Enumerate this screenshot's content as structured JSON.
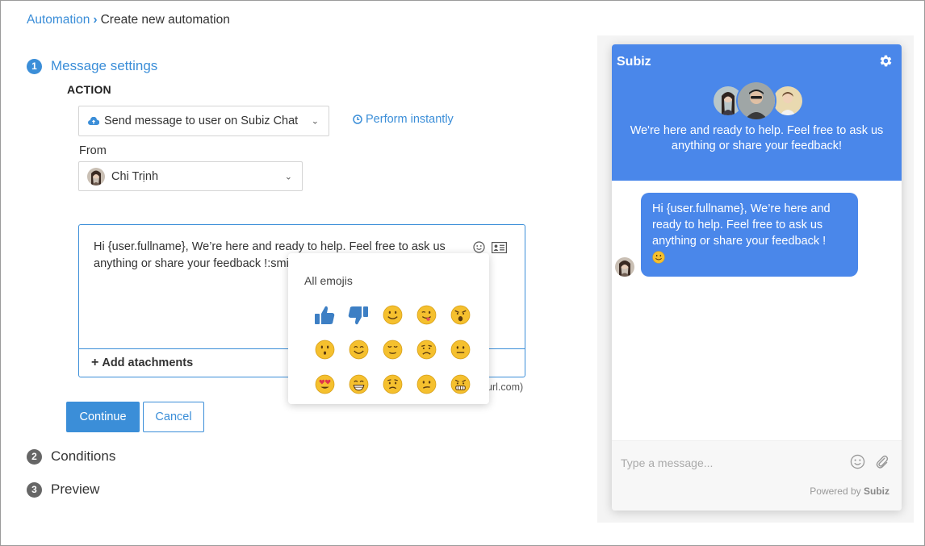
{
  "breadcrumb": {
    "parent": "Automation",
    "separator": "›",
    "current": "Create new automation"
  },
  "steps": [
    {
      "num": "1",
      "label": "Message settings",
      "state": "active"
    },
    {
      "num": "2",
      "label": "Conditions",
      "state": "inactive"
    },
    {
      "num": "3",
      "label": "Preview",
      "state": "inactive"
    }
  ],
  "action": {
    "label": "ACTION",
    "select_value": "Send message to user on Subiz Chat",
    "perform_link": "Perform instantly"
  },
  "from": {
    "label": "From",
    "select_value": "Chi Trịnh"
  },
  "editor": {
    "text_line1": "Hi {user.fullname}, We’re here and ready to help. Feel free to ask us",
    "text_line2": "anything or share your feedback !:smile:",
    "add_attachments": "Add atachments",
    "hint_fragment": "url.com)"
  },
  "buttons": {
    "continue": "Continue",
    "cancel": "Cancel"
  },
  "emoji_popup": {
    "title": "All emojis",
    "emojis": [
      "thumbs-up",
      "thumbs-down",
      "smile",
      "tongue-wink",
      "angry-shout",
      "surprised",
      "happy",
      "tearful-smile",
      "sad",
      "neutral",
      "heart-eyes",
      "grin",
      "worried",
      "confused",
      "grimace"
    ]
  },
  "chat": {
    "brand": "Subiz",
    "welcome": "We're here and ready to help. Feel free to ask us anything or share your feedback!",
    "message": "Hi {user.fullname}, We’re here and ready to help. Feel free to ask us anything or share your feedback !",
    "input_placeholder": "Type a message...",
    "powered_prefix": "Powered by",
    "powered_brand": "Subiz"
  },
  "colors": {
    "accent": "#3b8ed8",
    "chat_blue": "#4a87ea",
    "emoji_yellow": "#f5c02e",
    "thumb_blue": "#3d7fc4"
  }
}
